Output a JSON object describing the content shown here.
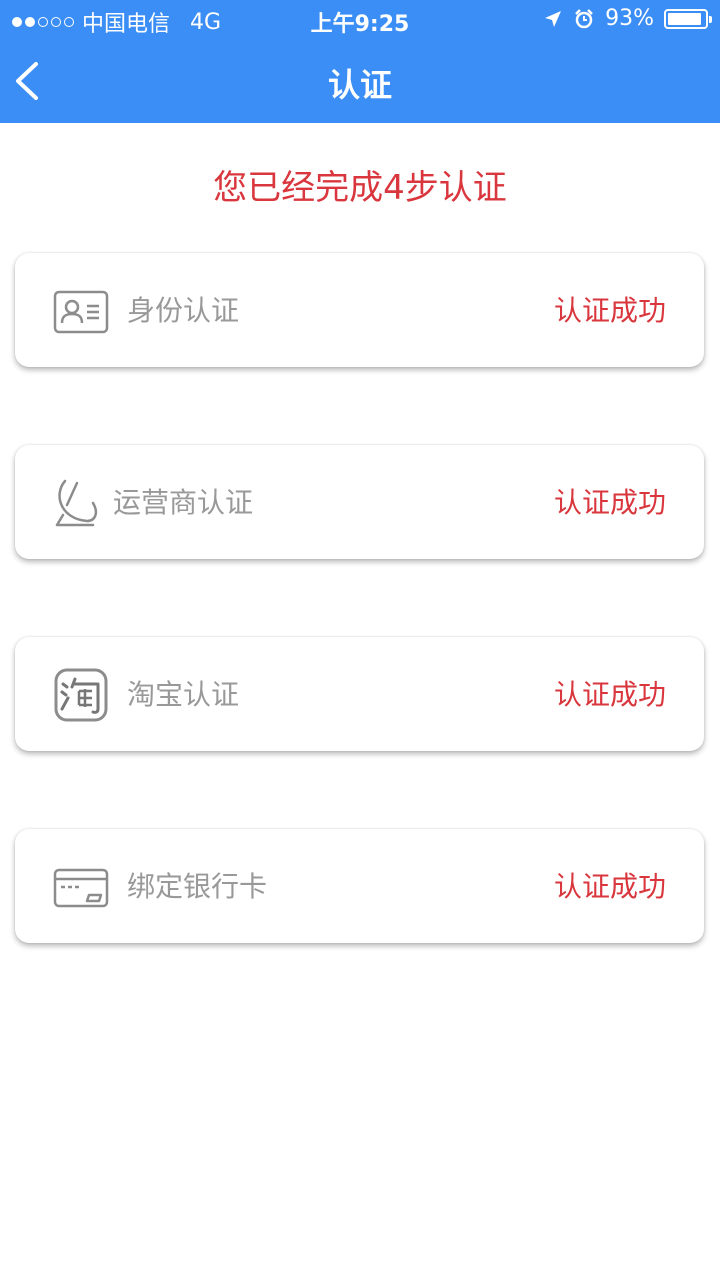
{
  "status_bar": {
    "carrier": "中国电信",
    "network": "4G",
    "time": "上午9:25",
    "battery": "93%",
    "battery_level": 0.93
  },
  "nav": {
    "title": "认证"
  },
  "summary": "您已经完成4步认证",
  "colors": {
    "header": "#3b8ef5",
    "accent_red": "#d9363e",
    "label_gray": "#999999"
  },
  "items": [
    {
      "label": "身份认证",
      "status": "认证成功",
      "icon": "id-card-icon"
    },
    {
      "label": "运营商认证",
      "status": "认证成功",
      "icon": "satellite-dish-icon"
    },
    {
      "label": "淘宝认证",
      "status": "认证成功",
      "icon": "taobao-icon"
    },
    {
      "label": "绑定银行卡",
      "status": "认证成功",
      "icon": "bank-card-icon"
    }
  ]
}
